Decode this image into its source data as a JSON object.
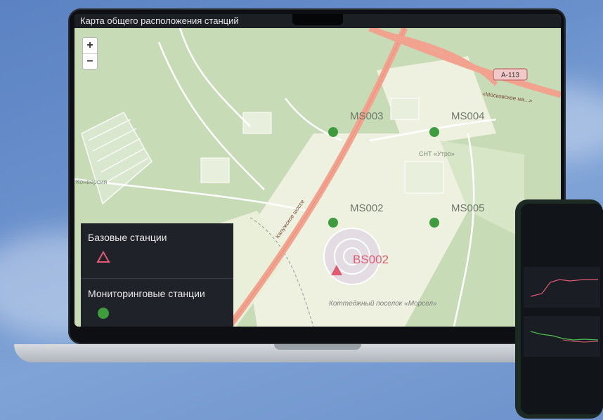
{
  "app": {
    "title": "Карта общего расположения станций"
  },
  "map": {
    "zoom_in": "+",
    "zoom_out": "−",
    "road_a113": "А-113",
    "road_moskovskoe": "«Московское ма...»",
    "road_kaluzhskoe": "Калужское шоссе",
    "place_snt": "СНТ «Утро»",
    "place_kottedzh": "Коттеджный поселок «Морсел»",
    "place_konversia": "Конверсия"
  },
  "stations": {
    "monitoring": [
      {
        "label": "MS003"
      },
      {
        "label": "MS004"
      },
      {
        "label": "MS002"
      },
      {
        "label": "MS005"
      }
    ],
    "base": [
      {
        "label": "BS002"
      }
    ]
  },
  "legend": {
    "base_title": "Базовые станции",
    "monitoring_title": "Мониторинговые станции"
  },
  "colors": {
    "monitoring_marker": "#3e9c3e",
    "base_marker": "#e05a72",
    "legend_bg": "#1f2329",
    "map_forest": "#c9dcb9",
    "road": "#f1a38f"
  }
}
